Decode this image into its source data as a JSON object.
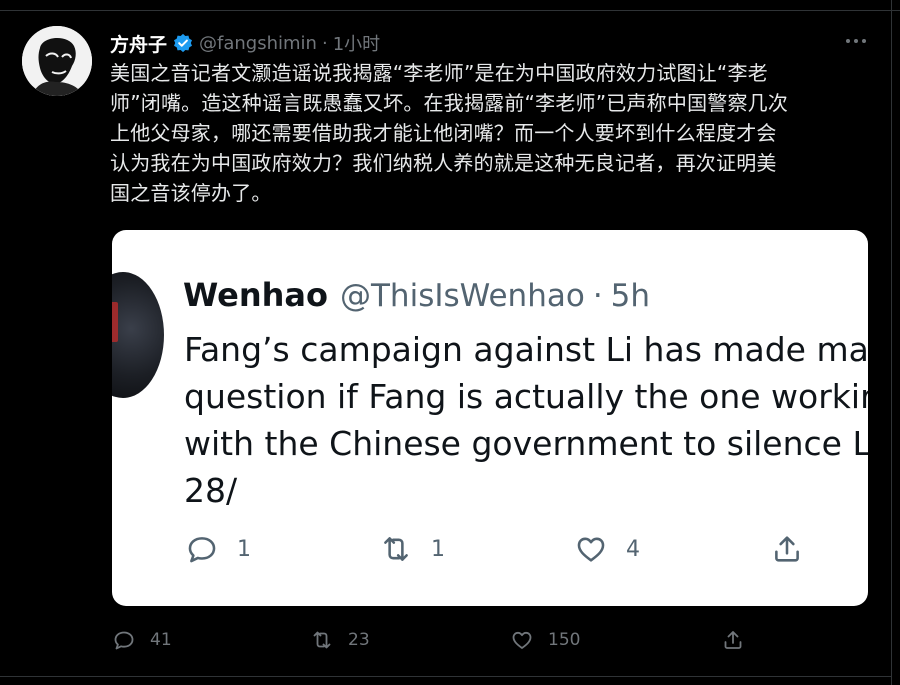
{
  "tweet": {
    "author_name": "方舟子",
    "handle": "@fangshimin",
    "separator": "·",
    "time": "1小时",
    "text": "美国之音记者文灏造谣说我揭露“李老师”是在为中国政府效力试图让“李老\n师”闭嘴。造这种谣言既愚蠢又坏。在我揭露前“李老师”已声称中国警察几次\n上他父母家，哪还需要借助我才能让他闭嘴？而一个人要坏到什么程度才会\n认为我在为中国政府效力？我们纳税人养的就是这种无良记者，再次证明美\n国之音该停办了。",
    "icons": {
      "verified": "verified-badge-icon",
      "more": "more-icon"
    },
    "stats": {
      "replies": "41",
      "retweets": "23",
      "likes": "150"
    }
  },
  "quoted_tweet": {
    "author_name": "Wenhao",
    "handle": "@ThisIsWenhao",
    "separator": "·",
    "time": "5h",
    "text_lines": [
      "Fang’s campaign against Li has made mar",
      "question if Fang is actually the one workir",
      "with the Chinese government to silence Li",
      "28/"
    ],
    "stats": {
      "replies": "1",
      "retweets": "1",
      "likes": "4"
    }
  },
  "colors": {
    "background": "#000000",
    "accent": "#1d9bf0",
    "muted": "#71767b",
    "card": "#ffffff"
  }
}
